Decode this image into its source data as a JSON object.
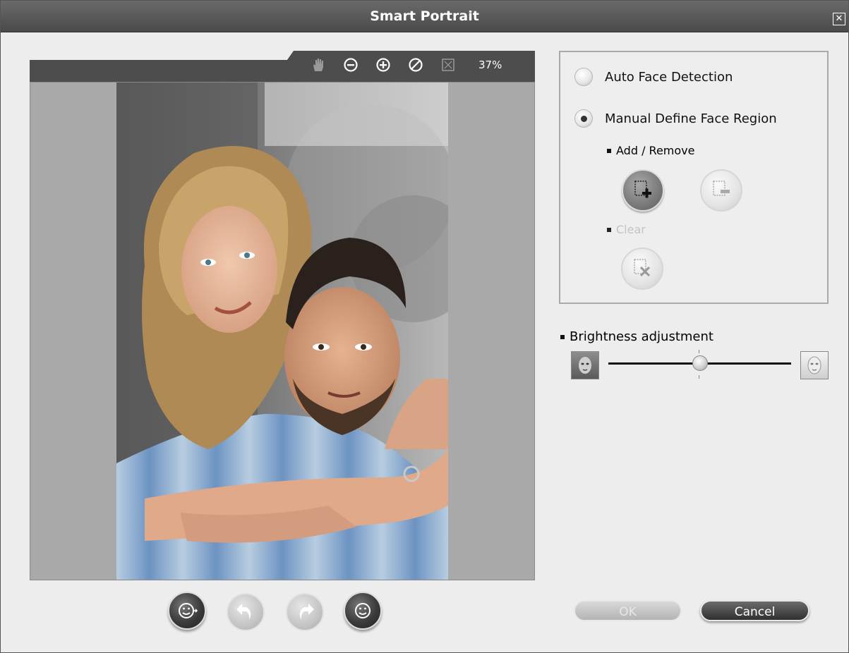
{
  "window": {
    "title": "Smart Portrait",
    "close_icon": "close-icon"
  },
  "viewer": {
    "tools": [
      "hand-icon",
      "zoom-out-icon",
      "zoom-in-icon",
      "reset-icon",
      "fit-icon"
    ],
    "zoom_level": "37%"
  },
  "bottom_actions": [
    {
      "icon": "face-apply-icon",
      "state": "active"
    },
    {
      "icon": "undo-icon",
      "state": "disabled"
    },
    {
      "icon": "redo-icon",
      "state": "disabled"
    },
    {
      "icon": "face-preview-icon",
      "state": "active"
    }
  ],
  "face_panel": {
    "auto_label": "Auto Face Detection",
    "manual_label": "Manual Define Face Region",
    "selected": "manual",
    "add_remove_label": "Add / Remove",
    "clear_label": "Clear",
    "add_button": {
      "icon": "add-face-region-icon",
      "state": "active"
    },
    "remove_button": {
      "icon": "remove-face-region-icon",
      "state": "disabled"
    },
    "clear_button": {
      "icon": "clear-face-regions-icon",
      "state": "disabled"
    }
  },
  "brightness": {
    "label": "Brightness adjustment",
    "min_icon": "dark-face-icon",
    "max_icon": "bright-face-icon",
    "value_fraction": 0.5
  },
  "buttons": {
    "ok": "OK",
    "cancel": "Cancel"
  },
  "colors": {
    "titlebar": "#555555",
    "panel_bg": "#ededed",
    "canvas_bg": "#a9a9a9"
  }
}
